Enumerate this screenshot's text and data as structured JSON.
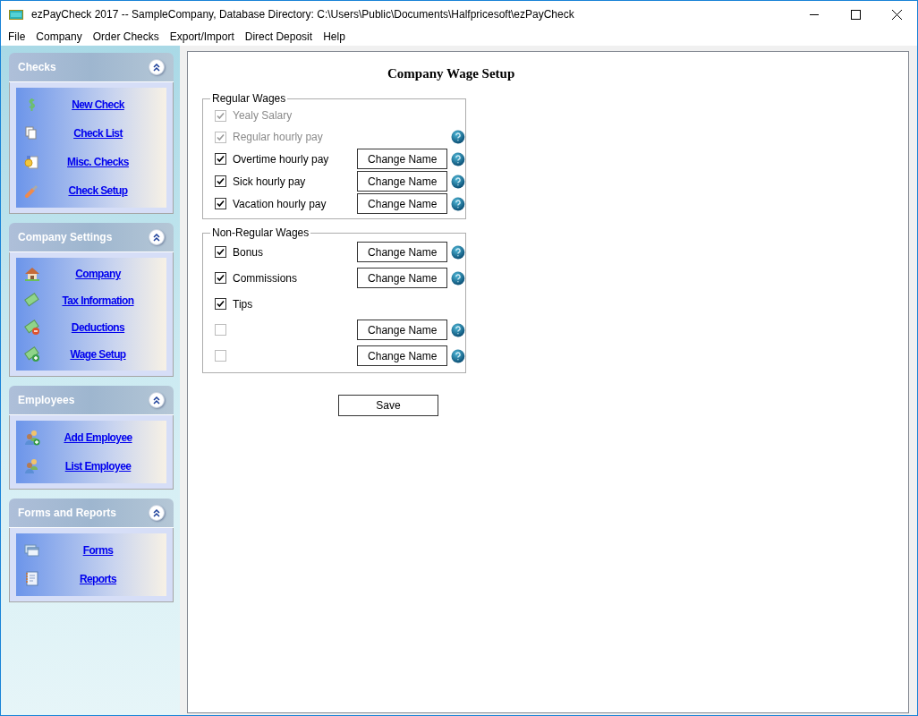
{
  "window": {
    "title": "ezPayCheck 2017 -- SampleCompany, Database Directory: C:\\Users\\Public\\Documents\\Halfpricesoft\\ezPayCheck"
  },
  "menu": [
    "File",
    "Company",
    "Order Checks",
    "Export/Import",
    "Direct Deposit",
    "Help"
  ],
  "sidebar": [
    {
      "title": "Checks",
      "expanded": true,
      "items": [
        {
          "label": "New Check"
        },
        {
          "label": "Check List"
        },
        {
          "label": "Misc. Checks"
        },
        {
          "label": "Check Setup"
        }
      ]
    },
    {
      "title": "Company Settings",
      "expanded": true,
      "items": [
        {
          "label": "Company"
        },
        {
          "label": "Tax Information"
        },
        {
          "label": "Deductions"
        },
        {
          "label": "Wage Setup"
        }
      ]
    },
    {
      "title": "Employees",
      "expanded": true,
      "items": [
        {
          "label": "Add Employee"
        },
        {
          "label": "List Employee"
        }
      ]
    },
    {
      "title": "Forms and Reports",
      "expanded": true,
      "items": [
        {
          "label": "Forms"
        },
        {
          "label": "Reports"
        }
      ]
    }
  ],
  "page": {
    "title": "Company Wage Setup",
    "groups": [
      {
        "title": "Regular Wages",
        "rows": [
          {
            "label": "Yealy Salary",
            "checked": true,
            "disabled": true,
            "help": false
          },
          {
            "label": "Regular hourly pay",
            "checked": true,
            "disabled": true,
            "help": true
          },
          {
            "label": "Overtime hourly pay",
            "checked": true,
            "disabled": false,
            "button": "Change Name",
            "help": true
          },
          {
            "label": "Sick hourly pay",
            "checked": true,
            "disabled": false,
            "button": "Change Name",
            "help": true
          },
          {
            "label": "Vacation hourly pay",
            "checked": true,
            "disabled": false,
            "button": "Change Name",
            "help": true
          }
        ]
      },
      {
        "title": "Non-Regular Wages",
        "rows": [
          {
            "label": "Bonus",
            "checked": true,
            "disabled": false,
            "button": "Change Name",
            "help": true
          },
          {
            "label": "Commissions",
            "checked": true,
            "disabled": false,
            "button": "Change Name",
            "help": true
          },
          {
            "label": "Tips",
            "checked": true,
            "disabled": false,
            "help": false
          },
          {
            "checked": false,
            "disabled": true,
            "button": "Change Name",
            "help": true
          },
          {
            "checked": false,
            "disabled": true,
            "button": "Change Name",
            "help": true
          }
        ]
      }
    ],
    "save_button": "Save"
  }
}
